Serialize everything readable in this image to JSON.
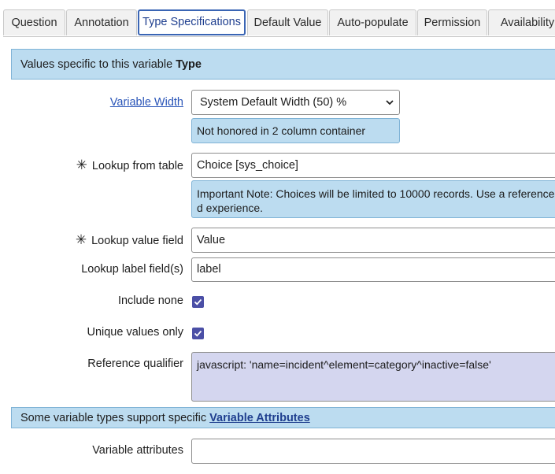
{
  "tabs": [
    "Question",
    "Annotation",
    "Type Specifications",
    "Default Value",
    "Auto-populate",
    "Permission",
    "Availability"
  ],
  "active_tab": "Type Specifications",
  "type_banner": {
    "prefix": "Values specific to this variable ",
    "bold": "Type"
  },
  "variable_width": {
    "label": "Variable Width",
    "value": "System Default Width (50) %",
    "note": "Not honored in 2 column container"
  },
  "lookup_table": {
    "label": "Lookup from table",
    "value": "Choice [sys_choice]",
    "note": "Important Note: Choices will be limited to 10000 records. Use a reference d experience."
  },
  "lookup_value": {
    "label": "Lookup value field",
    "value": "Value"
  },
  "lookup_label": {
    "label": "Lookup label field(s)",
    "value": "label"
  },
  "include_none": {
    "label": "Include none",
    "checked": true
  },
  "unique_values": {
    "label": "Unique values only",
    "checked": true
  },
  "reference_qualifier": {
    "label": "Reference qualifier",
    "value": "javascript: 'name=incident^element=category^inactive=false'"
  },
  "attributes_banner": {
    "prefix": "Some variable types support specific ",
    "link": "Variable Attributes"
  },
  "variable_attributes": {
    "label": "Variable attributes",
    "value": ""
  },
  "required_marker": "✳",
  "icons": {
    "dropdown": "chevron-down-icon",
    "checkbox": "checkmark-icon"
  },
  "colors": {
    "banner": "#bcdcf0",
    "accent": "#3a65b4",
    "checkbox": "#4b4fa6",
    "qualifier_bg": "#d4d6ef"
  }
}
